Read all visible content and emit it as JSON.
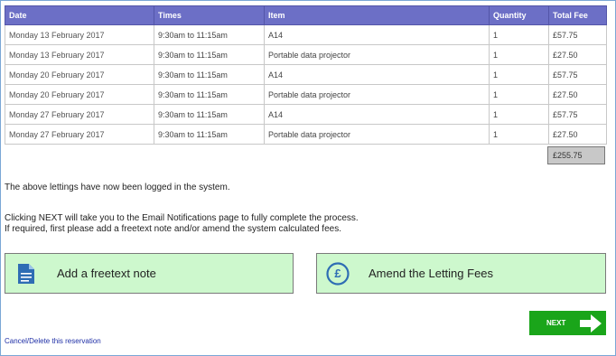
{
  "table": {
    "headers": [
      "Date",
      "Times",
      "Item",
      "Quantity",
      "Total Fee"
    ],
    "rows": [
      [
        "Monday 13 February 2017",
        "9:30am to 11:15am",
        "A14",
        "1",
        "£57.75"
      ],
      [
        "Monday 13 February 2017",
        "9:30am to 11:15am",
        "Portable data projector",
        "1",
        "£27.50"
      ],
      [
        "Monday 20 February 2017",
        "9:30am to 11:15am",
        "A14",
        "1",
        "£57.75"
      ],
      [
        "Monday 20 February 2017",
        "9:30am to 11:15am",
        "Portable data projector",
        "1",
        "£27.50"
      ],
      [
        "Monday 27 February 2017",
        "9:30am to 11:15am",
        "A14",
        "1",
        "£57.75"
      ],
      [
        "Monday 27 February 2017",
        "9:30am to 11:15am",
        "Portable data projector",
        "1",
        "£27.50"
      ]
    ],
    "total": "£255.75"
  },
  "messages": {
    "logged": "The above lettings have now been logged in the system.",
    "next_info": "Clicking NEXT will take you to the Email Notifications page to fully complete the process.",
    "required_info": "If required, first please add a freetext note and/or amend the system calculated fees."
  },
  "actions": {
    "freetext_label": "Add a freetext note",
    "fees_label": "Amend the Letting Fees",
    "fees_symbol": "£",
    "next_label": "NEXT"
  },
  "links": {
    "cancel": "Cancel/Delete this reservation"
  },
  "colors": {
    "header_bg": "#6c6fc6",
    "button_bg": "#cdf8cd",
    "next_bg": "#1aa51a",
    "icon_blue": "#2e6db4",
    "link": "#1f2fa6"
  },
  "icons": {
    "freetext": "document-icon",
    "fees": "pound-circle-icon",
    "next": "arrow-right-icon"
  }
}
